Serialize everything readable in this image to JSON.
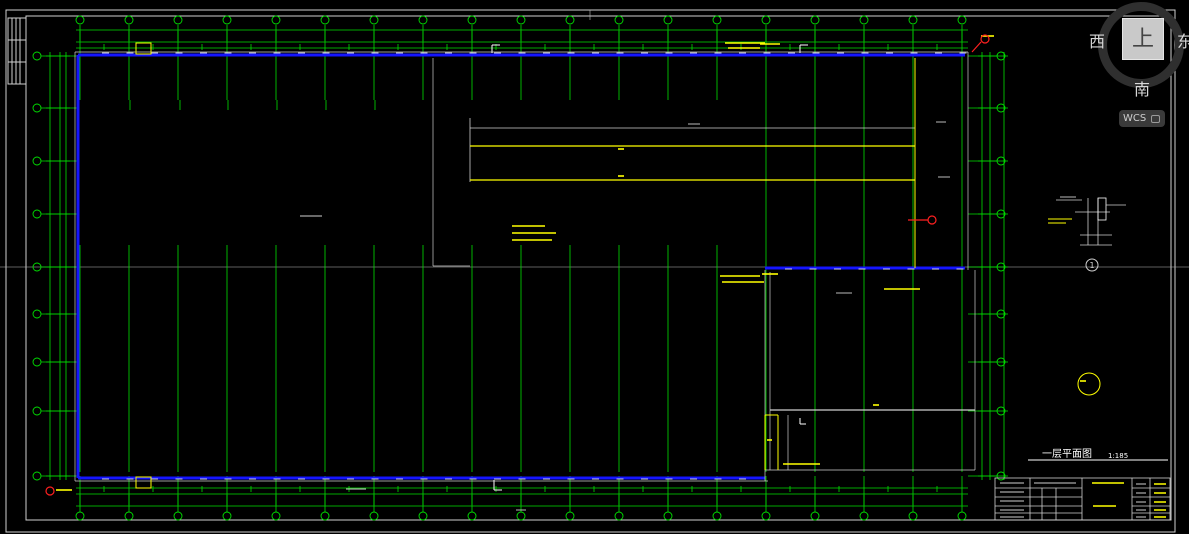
{
  "viewcube": {
    "face_top": "上",
    "west": "西",
    "east": "东",
    "south": "南",
    "wcs_label": "WCS"
  },
  "drawing": {
    "title": "一层平面图",
    "scale": "1:185",
    "detail_number": "1"
  },
  "colors": {
    "background": "#000000",
    "axis_lines": "#00ff00",
    "walls": "#0000ff",
    "annotation": "#ffff00",
    "markers": "#ff0000",
    "frame": "#ffffff"
  }
}
